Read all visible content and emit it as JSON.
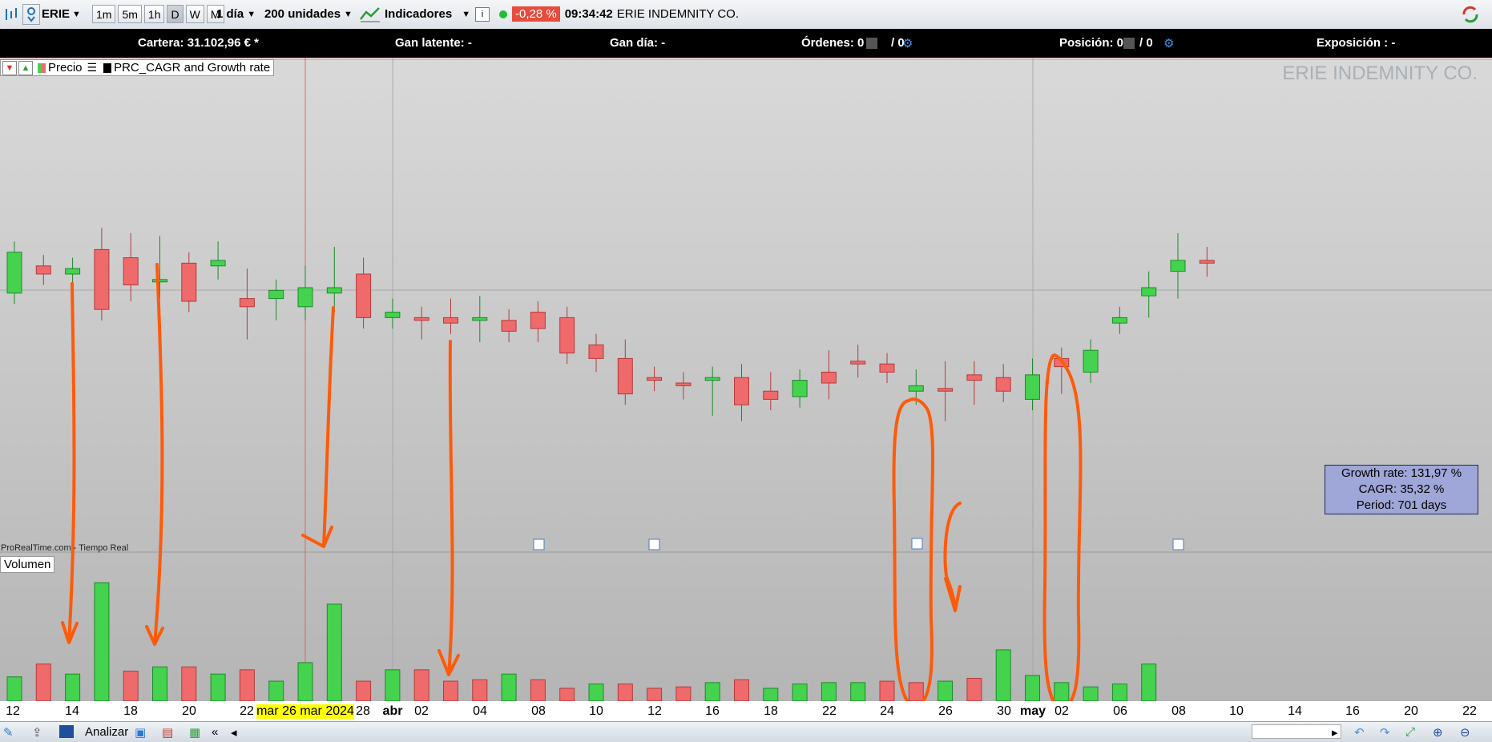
{
  "toolbar": {
    "ticker": "ERIE",
    "timeframes": [
      "1m",
      "5m",
      "1h",
      "D",
      "W",
      "M"
    ],
    "active_timeframe": "D",
    "period": "1 día",
    "units": "200 unidades",
    "indicators": "Indicadores",
    "change": "-0,28 %",
    "time": "09:34:42",
    "company": "ERIE INDEMNITY CO."
  },
  "infobar": {
    "cartera": "Cartera: 31.102,96 € *",
    "gan_latente": "Gan latente: -",
    "gan_dia": "Gan día: -",
    "ordenes": "Órdenes: 0",
    "ordenes_count": "/ 0",
    "posicion": "Posición: 0",
    "posicion_count": "/ 0",
    "exposicion": "Exposición : -"
  },
  "legend": {
    "precio": "Precio",
    "indicator": "PRC_CAGR and Growth rate"
  },
  "watermark": "ERIE INDEMNITY CO.",
  "growth_box": {
    "growth": "Growth rate: 131,97  %",
    "cagr": "CAGR: 35,32  %",
    "period": "Period: 701  days"
  },
  "provider": "ProRealTime.com - Tiempo Real",
  "volume_legend": "Volumen",
  "xaxis": {
    "labels": [
      "12",
      "14",
      "18",
      "20",
      "22",
      "28",
      "abr",
      "02",
      "04",
      "08",
      "10",
      "12",
      "16",
      "18",
      "22",
      "24",
      "26",
      "30",
      "may",
      "02",
      "06",
      "08",
      "10",
      "14",
      "16",
      "20",
      "22"
    ],
    "highlight": "mar 26 mar 2024"
  },
  "statusbar": {
    "analizar": "Analizar"
  },
  "colors": {
    "up": "#45d24e",
    "down": "#ef6b6b",
    "annotation": "#ff5a0a"
  },
  "chart_data": {
    "type": "candlestick",
    "candles": [
      {
        "o": 0.43,
        "h": 0.37,
        "l": 0.59,
        "c": 0.58
      },
      {
        "o": 0.53,
        "h": 0.47,
        "l": 0.53,
        "c": 0.5
      },
      {
        "o": 0.5,
        "h": 0.52,
        "l": 0.44,
        "c": 0.52
      },
      {
        "o": 0.59,
        "h": 0.63,
        "l": 0.37,
        "c": 0.37
      },
      {
        "o": 0.56,
        "h": 0.61,
        "l": 0.44,
        "c": 0.46
      },
      {
        "o": 0.48,
        "h": 0.6,
        "l": 0.45,
        "c": 0.48
      },
      {
        "o": 0.54,
        "h": 0.51,
        "l": 0.4,
        "c": 0.4
      },
      {
        "o": 0.53,
        "h": 0.58,
        "l": 0.52,
        "c": 0.55
      },
      {
        "o": 0.41,
        "h": 0.48,
        "l": 0.3,
        "c": 0.38
      },
      {
        "o": 0.41,
        "h": 0.44,
        "l": 0.37,
        "c": 0.44
      },
      {
        "o": 0.38,
        "h": 0.49,
        "l": 0.37,
        "c": 0.45
      },
      {
        "o": 0.43,
        "h": 0.56,
        "l": 0.4,
        "c": 0.45
      },
      {
        "o": 0.5,
        "h": 0.52,
        "l": 0.34,
        "c": 0.34
      },
      {
        "o": 0.34,
        "h": 0.37,
        "l": 0.36,
        "c": 0.36
      },
      {
        "o": 0.34,
        "h": 0.32,
        "l": 0.3,
        "c": 0.33
      },
      {
        "o": 0.34,
        "h": 0.37,
        "l": 0.37,
        "c": 0.32
      },
      {
        "o": 0.33,
        "h": 0.38,
        "l": 0.29,
        "c": 0.34
      },
      {
        "o": 0.33,
        "h": 0.32,
        "l": 0.29,
        "c": 0.29
      },
      {
        "o": 0.36,
        "h": 0.33,
        "l": 0.29,
        "c": 0.3
      },
      {
        "o": 0.34,
        "h": 0.34,
        "l": 0.21,
        "c": 0.21
      },
      {
        "o": 0.24,
        "h": 0.15,
        "l": 0.18,
        "c": 0.19
      },
      {
        "o": 0.19,
        "h": 0.22,
        "l": 0.06,
        "c": 0.06
      },
      {
        "o": 0.12,
        "h": 0.12,
        "l": 0.11,
        "c": 0.11
      },
      {
        "o": 0.1,
        "h": 0.08,
        "l": 0.08,
        "c": 0.09
      },
      {
        "o": 0.11,
        "h": 0.02,
        "l": 0.02,
        "c": 0.12
      },
      {
        "o": 0.12,
        "h": 0.13,
        "l": 0.0,
        "c": 0.02
      },
      {
        "o": 0.07,
        "h": 0.1,
        "l": 0.07,
        "c": 0.04
      },
      {
        "o": 0.05,
        "h": 0.1,
        "l": 0.05,
        "c": 0.11
      },
      {
        "o": 0.14,
        "h": 0.18,
        "l": 0.08,
        "c": 0.1
      },
      {
        "o": 0.18,
        "h": 0.2,
        "l": 0.16,
        "c": 0.17
      },
      {
        "o": 0.17,
        "h": 0.15,
        "l": 0.15,
        "c": 0.14
      },
      {
        "o": 0.07,
        "h": 0.11,
        "l": 0.06,
        "c": 0.09
      },
      {
        "o": 0.08,
        "h": 0.14,
        "l": 0.0,
        "c": 0.07
      },
      {
        "o": 0.13,
        "h": 0.14,
        "l": 0.06,
        "c": 0.11
      },
      {
        "o": 0.12,
        "h": 0.13,
        "l": 0.07,
        "c": 0.07
      },
      {
        "o": 0.04,
        "h": 0.15,
        "l": 0.1,
        "c": 0.13
      },
      {
        "o": 0.19,
        "h": 0.17,
        "l": 0.1,
        "c": 0.16
      },
      {
        "o": 0.14,
        "h": 0.2,
        "l": 0.19,
        "c": 0.22
      },
      {
        "o": 0.32,
        "h": 0.29,
        "l": 0.35,
        "c": 0.34
      },
      {
        "o": 0.42,
        "h": 0.47,
        "l": 0.38,
        "c": 0.45
      },
      {
        "o": 0.51,
        "h": 0.61,
        "l": 0.45,
        "c": 0.55
      },
      {
        "o": 0.55,
        "h": 0.56,
        "l": 0.53,
        "c": 0.54
      }
    ],
    "volume": [
      {
        "v": 0.17,
        "up": true
      },
      {
        "v": 0.26,
        "up": false
      },
      {
        "v": 0.19,
        "up": true
      },
      {
        "v": 0.83,
        "up": true
      },
      {
        "v": 0.21,
        "up": false
      },
      {
        "v": 0.24,
        "up": true
      },
      {
        "v": 0.24,
        "up": false
      },
      {
        "v": 0.19,
        "up": true
      },
      {
        "v": 0.22,
        "up": false
      },
      {
        "v": 0.14,
        "up": true
      },
      {
        "v": 0.27,
        "up": true
      },
      {
        "v": 0.68,
        "up": true
      },
      {
        "v": 0.14,
        "up": false
      },
      {
        "v": 0.22,
        "up": true
      },
      {
        "v": 0.22,
        "up": false
      },
      {
        "v": 0.14,
        "up": false
      },
      {
        "v": 0.15,
        "up": false
      },
      {
        "v": 0.19,
        "up": true
      },
      {
        "v": 0.15,
        "up": false
      },
      {
        "v": 0.09,
        "up": false
      },
      {
        "v": 0.12,
        "up": true
      },
      {
        "v": 0.12,
        "up": false
      },
      {
        "v": 0.09,
        "up": false
      },
      {
        "v": 0.1,
        "up": false
      },
      {
        "v": 0.13,
        "up": true
      },
      {
        "v": 0.15,
        "up": false
      },
      {
        "v": 0.09,
        "up": true
      },
      {
        "v": 0.12,
        "up": true
      },
      {
        "v": 0.13,
        "up": true
      },
      {
        "v": 0.13,
        "up": true
      },
      {
        "v": 0.14,
        "up": false
      },
      {
        "v": 0.13,
        "up": false
      },
      {
        "v": 0.14,
        "up": true
      },
      {
        "v": 0.16,
        "up": false
      },
      {
        "v": 0.36,
        "up": true
      },
      {
        "v": 0.18,
        "up": true
      },
      {
        "v": 0.13,
        "up": true
      },
      {
        "v": 0.1,
        "up": true
      },
      {
        "v": 0.12,
        "up": true
      },
      {
        "v": 0.26,
        "up": true
      }
    ]
  }
}
